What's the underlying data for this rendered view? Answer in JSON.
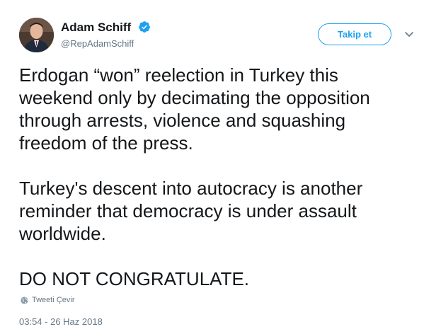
{
  "author": {
    "name": "Adam Schiff",
    "handle": "@RepAdamSchiff",
    "verified_icon": "verified-badge-icon",
    "avatar_icon": "avatar-photo"
  },
  "actions": {
    "follow_label": "Takip et",
    "more_icon": "chevron-down-icon"
  },
  "tweet": {
    "paragraphs": [
      "Erdogan “won” reelection in Turkey this weekend only by decimating the opposition through arrests, violence and squashing freedom of the press.",
      "Turkey's descent into autocracy is another reminder that democracy is under assault worldwide.",
      "DO NOT CONGRATULATE."
    ],
    "translate_label": "Tweeti Çevir",
    "translate_icon": "globe-icon",
    "timestamp": "03:54 - 26 Haz 2018"
  },
  "colors": {
    "accent": "#1da1f2",
    "text": "#14171a",
    "muted": "#657786"
  }
}
